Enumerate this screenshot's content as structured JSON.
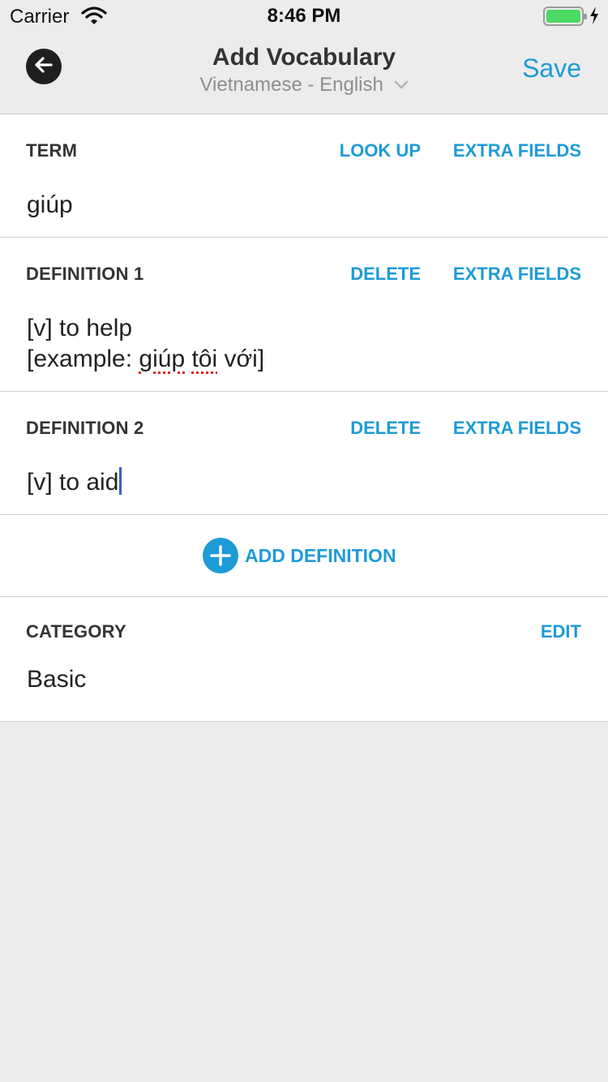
{
  "status_bar": {
    "carrier": "Carrier",
    "time": "8:46 PM"
  },
  "nav": {
    "title": "Add Vocabulary",
    "subtitle": "Vietnamese - English",
    "save_label": "Save",
    "back_icon": "arrow-left-icon"
  },
  "term": {
    "label": "TERM",
    "look_up": "LOOK UP",
    "extra_fields": "EXTRA FIELDS",
    "value": "giúp"
  },
  "definition1": {
    "label": "DEFINITION 1",
    "delete": "DELETE",
    "extra_fields": "EXTRA FIELDS",
    "line1": "[v] to help",
    "line2_prefix": "[example: ",
    "line2_word1": "giúp",
    "line2_word2": "tôi",
    "line2_suffix": " với]"
  },
  "definition2": {
    "label": "DEFINITION 2",
    "delete": "DELETE",
    "extra_fields": "EXTRA FIELDS",
    "value": "[v] to aid"
  },
  "add_definition": {
    "label": "ADD DEFINITION"
  },
  "category": {
    "label": "CATEGORY",
    "edit": "EDIT",
    "value": "Basic"
  },
  "colors": {
    "accent": "#1e9bd7",
    "background": "#ececec",
    "battery": "#4cd964"
  }
}
